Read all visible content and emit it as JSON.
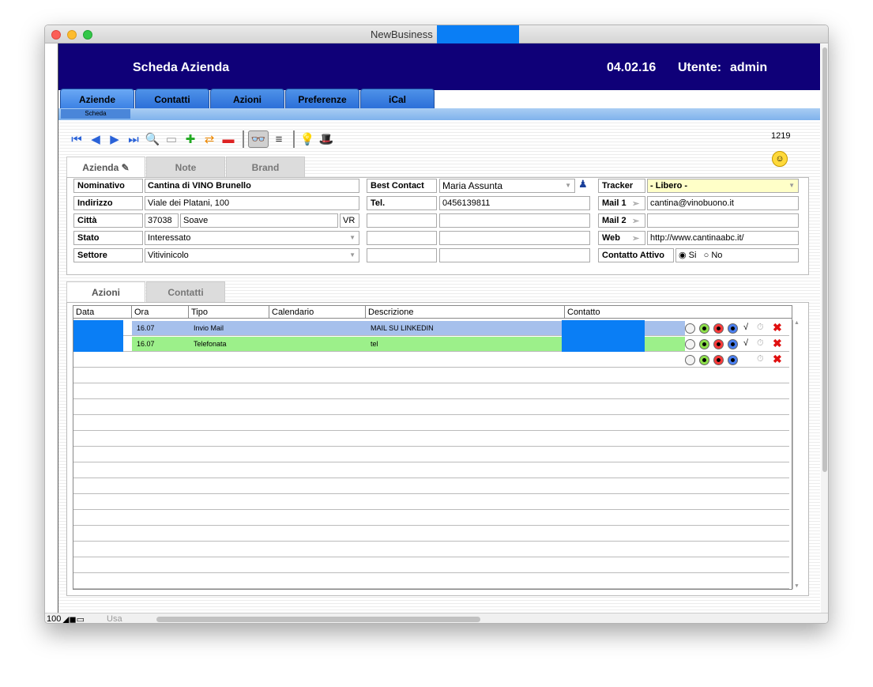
{
  "window": {
    "title": "NewBusiness"
  },
  "header": {
    "title": "Scheda Azienda",
    "date": "04.02.16",
    "user_label": "Utente:",
    "user": "admin"
  },
  "tabs": [
    {
      "label": "Aziende"
    },
    {
      "label": "Contatti"
    },
    {
      "label": "Azioni"
    },
    {
      "label": "Preferenze"
    },
    {
      "label": "iCal"
    }
  ],
  "subtab": "Scheda",
  "record_count": "1219",
  "panel_tabs": [
    {
      "label": "Azienda"
    },
    {
      "label": "Note"
    },
    {
      "label": "Brand"
    }
  ],
  "form": {
    "nominativo_label": "Nominativo",
    "nominativo": "Cantina di VINO Brunello",
    "indirizzo_label": "Indirizzo",
    "indirizzo": "Viale dei Platani, 100",
    "citta_label": "Città",
    "cap": "37038",
    "citta": "Soave",
    "prov": "VR",
    "stato_label": "Stato",
    "stato": "Interessato",
    "settore_label": "Settore",
    "settore": "Vitivinicolo",
    "best_contact_label": "Best Contact",
    "best_contact": "Maria Assunta",
    "tel_label": "Tel.",
    "tel": "0456139811",
    "tracker_label": "Tracker",
    "tracker": "- Libero -",
    "mail1_label": "Mail 1",
    "mail1": "cantina@vinobuono.it",
    "mail2_label": "Mail 2",
    "mail2": "",
    "web_label": "Web",
    "web": "http://www.cantinaabc.it/",
    "attivo_label": "Contatto Attivo",
    "si": "Si",
    "no": "No"
  },
  "bottom_tabs": [
    {
      "label": "Azioni"
    },
    {
      "label": "Contatti"
    }
  ],
  "grid": {
    "headers": [
      "Data",
      "Ora",
      "Tipo",
      "Calendario",
      "Descrizione",
      "Contatto"
    ],
    "rows": [
      {
        "ora": "16.07",
        "tipo": "Invio Mail",
        "calendario": "",
        "descrizione": "MAIL SU LINKEDIN",
        "color": "#a6c0ec",
        "check": "√"
      },
      {
        "ora": "16.07",
        "tipo": "Telefonata",
        "calendario": "",
        "descrizione": "tel",
        "color": "#9cf08a",
        "check": "√"
      },
      {
        "ora": "",
        "tipo": "",
        "calendario": "",
        "descrizione": "",
        "color": "#ffffff",
        "check": ""
      }
    ]
  },
  "status": {
    "zoom": "100",
    "mode": "Usa"
  }
}
